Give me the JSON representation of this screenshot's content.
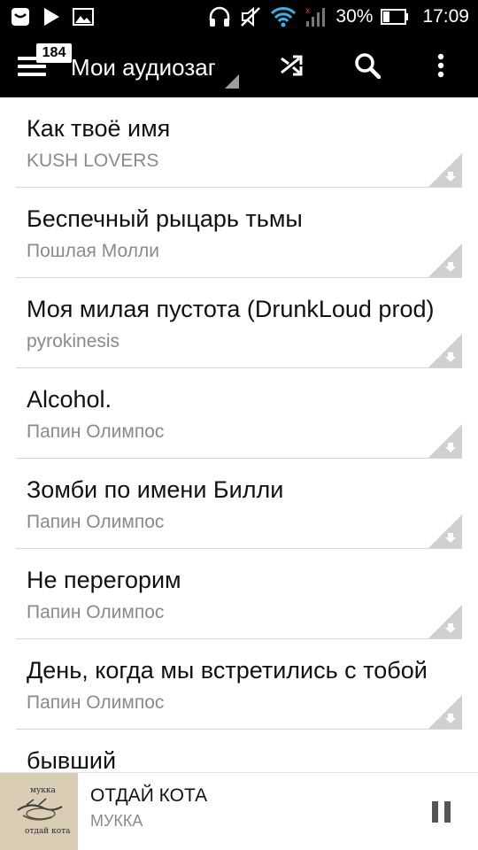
{
  "status_bar": {
    "battery": "30%",
    "time": "17:09",
    "icons": [
      "messenger-icon",
      "play-store-icon",
      "gallery-icon",
      "headphones-icon",
      "muted-icon",
      "wifi-icon",
      "signal-icon",
      "battery-icon"
    ]
  },
  "toolbar": {
    "badge": "184",
    "title": "Мои аудиозаписи",
    "icons": [
      "menu-icon",
      "shuffle-icon",
      "search-icon",
      "more-vert-icon"
    ]
  },
  "tracks": [
    {
      "title": "Как твоё имя",
      "artist": "KUSH LOVERS"
    },
    {
      "title": "Беспечный рыцарь тьмы",
      "artist": "Пошлая Молли"
    },
    {
      "title": "Моя милая пустота (DrunkLoud prod)",
      "artist": "pyrokinesis"
    },
    {
      "title": "Alcohol.",
      "artist": "Папин Олимпос"
    },
    {
      "title": "Зомби по имени Билли",
      "artist": "Папин Олимпос"
    },
    {
      "title": "Не перегорим",
      "artist": "Папин Олимпос"
    },
    {
      "title": "День, когда мы встретились с тобой",
      "artist": "Папин Олимпос"
    },
    {
      "title": "бывший",
      "artist": ""
    }
  ],
  "now_playing": {
    "title": "ОТДАЙ КОТА",
    "artist": "МУККА",
    "cover_text_top": "мукка",
    "cover_text_bottom": "отдай кота"
  },
  "colors": {
    "bar_bg": "#000000",
    "title_text": "#111111",
    "subtitle_text": "#8a8a8a",
    "divider": "#d6d6d6"
  }
}
